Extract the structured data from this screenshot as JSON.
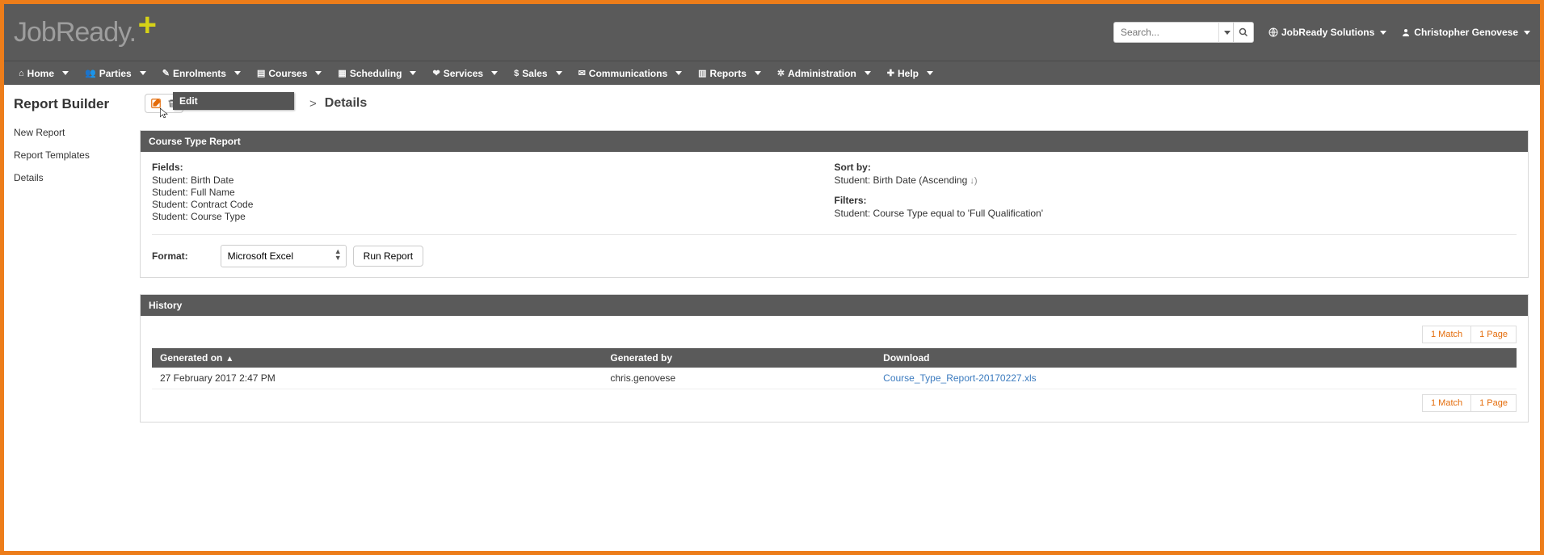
{
  "brand": {
    "name": "JobReady."
  },
  "top": {
    "search_placeholder": "Search...",
    "org_link": "JobReady Solutions",
    "user_link": "Christopher Genovese"
  },
  "menu": [
    {
      "icon": "home-icon",
      "glyph": "⌂",
      "label": "Home"
    },
    {
      "icon": "parties-icon",
      "glyph": "👥",
      "label": "Parties"
    },
    {
      "icon": "enrolments-icon",
      "glyph": "✎",
      "label": "Enrolments"
    },
    {
      "icon": "courses-icon",
      "glyph": "▤",
      "label": "Courses"
    },
    {
      "icon": "scheduling-icon",
      "glyph": "▦",
      "label": "Scheduling"
    },
    {
      "icon": "services-icon",
      "glyph": "❤",
      "label": "Services"
    },
    {
      "icon": "sales-icon",
      "glyph": "$",
      "label": "Sales"
    },
    {
      "icon": "communications-icon",
      "glyph": "✉",
      "label": "Communications"
    },
    {
      "icon": "reports-icon",
      "glyph": "▥",
      "label": "Reports"
    },
    {
      "icon": "administration-icon",
      "glyph": "✲",
      "label": "Administration"
    },
    {
      "icon": "help-icon",
      "glyph": "✚",
      "label": "Help"
    }
  ],
  "sidebar": {
    "title": "Report Builder",
    "items": [
      "New Report",
      "Report Templates",
      "Details"
    ]
  },
  "breadcrumb": {
    "tooltip": "Edit",
    "sep": ">",
    "current": "Details"
  },
  "report": {
    "title": "Course Type Report",
    "fields_label": "Fields:",
    "fields": [
      "Student: Birth Date",
      "Student: Full Name",
      "Student: Contract Code",
      "Student: Course Type"
    ],
    "sort_label": "Sort by:",
    "sort_items": [
      {
        "text": "Student: Birth Date (Ascending",
        "suffix": " ↓)"
      }
    ],
    "filters_label": "Filters:",
    "filters": [
      "Student: Course Type equal to 'Full Qualification'"
    ],
    "format_label": "Format:",
    "format_value": "Microsoft Excel",
    "run_label": "Run Report"
  },
  "history": {
    "title": "History",
    "pager_match": "1 Match",
    "pager_page": "1 Page",
    "cols": {
      "generated_on": "Generated on",
      "generated_by": "Generated by",
      "download": "Download"
    },
    "rows": [
      {
        "generated_on": "27 February 2017 2:47 PM",
        "generated_by": "chris.genovese",
        "download": "Course_Type_Report-20170227.xls"
      }
    ]
  }
}
